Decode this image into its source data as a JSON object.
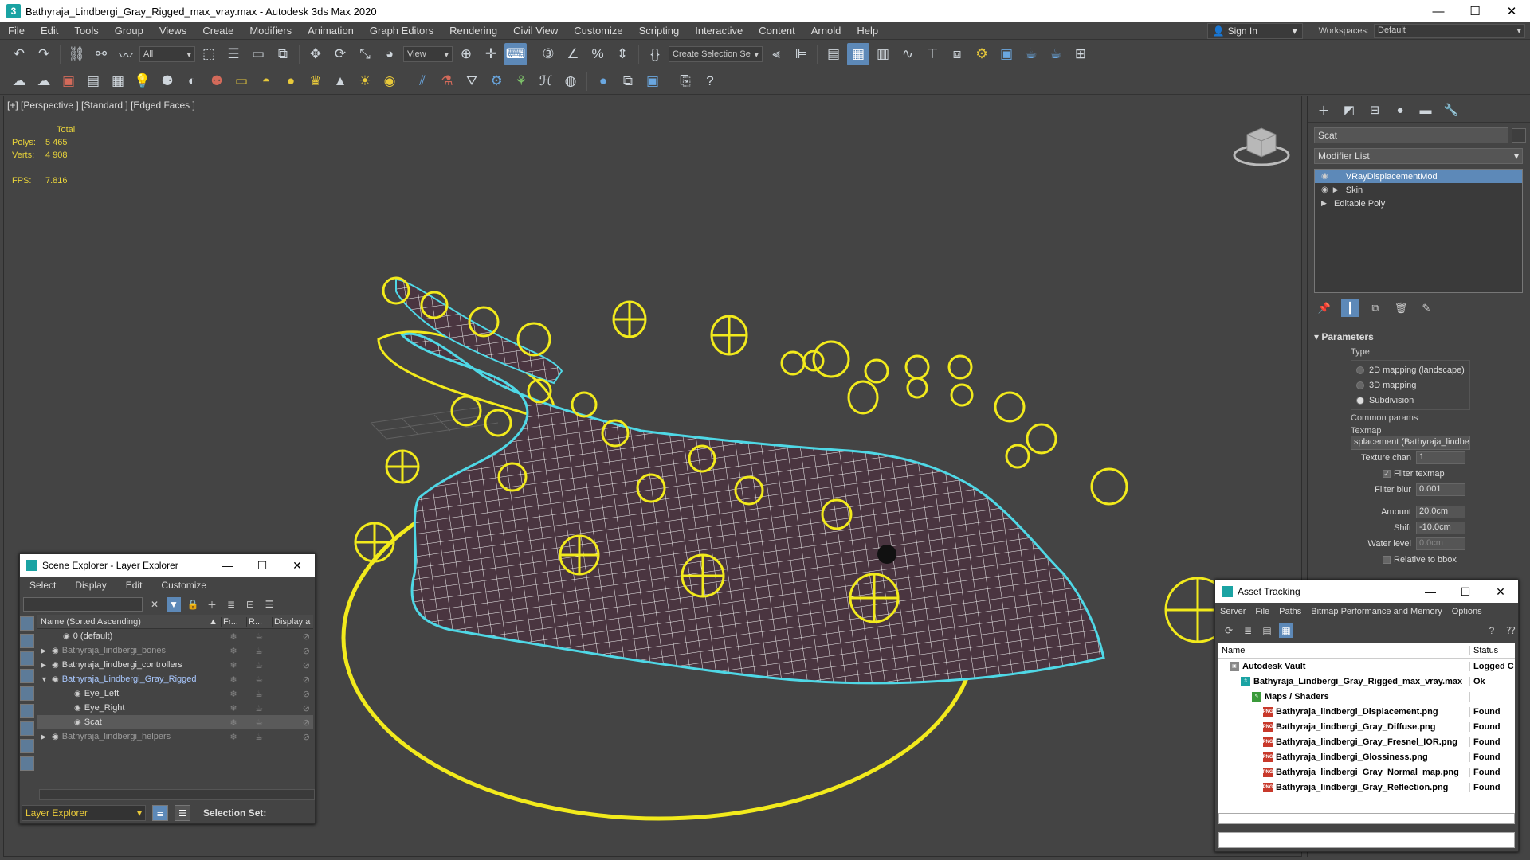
{
  "window": {
    "title": "Bathyraja_Lindbergi_Gray_Rigged_max_vray.max - Autodesk 3ds Max 2020",
    "app_icon": "3",
    "minimize": "—",
    "maximize": "☐",
    "close": "✕"
  },
  "menu": {
    "items": [
      "File",
      "Edit",
      "Tools",
      "Group",
      "Views",
      "Create",
      "Modifiers",
      "Animation",
      "Graph Editors",
      "Rendering",
      "Civil View",
      "Customize",
      "Scripting",
      "Interactive",
      "Content",
      "Arnold",
      "Help"
    ],
    "sign_in": "Sign In",
    "workspaces_label": "Workspaces:",
    "workspace_value": "Default"
  },
  "toolbar": {
    "filter_value": "All",
    "refcoord_value": "View",
    "selection_set_placeholder": "Create Selection Se"
  },
  "viewport": {
    "label": "[+] [Perspective ] [Standard ] [Edged Faces ]",
    "stats_header": "Total",
    "polys_label": "Polys:",
    "polys_value": "5 465",
    "verts_label": "Verts:",
    "verts_value": "4 908",
    "fps_label": "FPS:",
    "fps_value": "7.816"
  },
  "command_panel": {
    "object_name": "Scat",
    "modifier_list": "Modifier List",
    "stack": [
      "VRayDisplacementMod",
      "Skin",
      "Editable Poly"
    ],
    "parameters": {
      "title": "Parameters",
      "type_label": "Type",
      "type_options": [
        "2D mapping (landscape)",
        "3D mapping",
        "Subdivision"
      ],
      "type_selected": 2,
      "common_params": "Common params",
      "texmap_label": "Texmap",
      "texmap_value": "splacement (Bathyraja_lindbe",
      "texture_chan_label": "Texture chan",
      "texture_chan_value": "1",
      "filter_texmap_label": "Filter texmap",
      "filter_blur_label": "Filter blur",
      "filter_blur_value": "0.001",
      "amount_label": "Amount",
      "amount_value": "20.0cm",
      "shift_label": "Shift",
      "shift_value": "-10.0cm",
      "water_level_label": "Water level",
      "water_level_value": "0.0cm",
      "relative_bbox_label": "Relative to bbox"
    }
  },
  "scene_explorer": {
    "title": "Scene Explorer - Layer Explorer",
    "menu": [
      "Select",
      "Display",
      "Edit",
      "Customize"
    ],
    "columns": {
      "name": "Name (Sorted Ascending)",
      "frozen": "Fr...",
      "render": "R...",
      "display": "Display a"
    },
    "rows": [
      {
        "name": "0 (default)",
        "style": "normal",
        "indent": 1
      },
      {
        "name": "Bathyraja_lindbergi_bones",
        "style": "dim",
        "indent": 0
      },
      {
        "name": "Bathyraja_lindbergi_controllers",
        "style": "normal",
        "indent": 0
      },
      {
        "name": "Bathyraja_Lindbergi_Gray_Rigged",
        "style": "blue",
        "indent": 0
      },
      {
        "name": "Eye_Left",
        "style": "normal",
        "indent": 2
      },
      {
        "name": "Eye_Right",
        "style": "normal",
        "indent": 2
      },
      {
        "name": "Scat",
        "style": "normal",
        "indent": 2
      },
      {
        "name": "Bathyraja_lindbergi_helpers",
        "style": "dim",
        "indent": 0
      }
    ],
    "footer_layer": "Layer Explorer",
    "footer_selset": "Selection Set:"
  },
  "asset_tracking": {
    "title": "Asset Tracking",
    "menu": [
      "Server",
      "File",
      "Paths",
      "Bitmap Performance and Memory",
      "Options"
    ],
    "columns": {
      "name": "Name",
      "status": "Status"
    },
    "rows": [
      {
        "name": "Autodesk Vault",
        "status": "Logged C",
        "indent": 1,
        "icon": "vault"
      },
      {
        "name": "Bathyraja_Lindbergi_Gray_Rigged_max_vray.max",
        "status": "Ok",
        "indent": 2,
        "icon": "max"
      },
      {
        "name": "Maps / Shaders",
        "status": "",
        "indent": 3,
        "icon": "maps"
      },
      {
        "name": "Bathyraja_lindbergi_Displacement.png",
        "status": "Found",
        "indent": 4,
        "icon": "png"
      },
      {
        "name": "Bathyraja_lindbergi_Gray_Diffuse.png",
        "status": "Found",
        "indent": 4,
        "icon": "png"
      },
      {
        "name": "Bathyraja_lindbergi_Gray_Fresnel_IOR.png",
        "status": "Found",
        "indent": 4,
        "icon": "png"
      },
      {
        "name": "Bathyraja_lindbergi_Glossiness.png",
        "status": "Found",
        "indent": 4,
        "icon": "png"
      },
      {
        "name": "Bathyraja_lindbergi_Gray_Normal_map.png",
        "status": "Found",
        "indent": 4,
        "icon": "png"
      },
      {
        "name": "Bathyraja_lindbergi_Gray_Reflection.png",
        "status": "Found",
        "indent": 4,
        "icon": "png"
      }
    ]
  },
  "colors": {
    "accent": "#5d89b8",
    "controller": "#f2ea1c",
    "selection_outline": "#4fd8e6",
    "mesh_wire": "#ffffff"
  }
}
